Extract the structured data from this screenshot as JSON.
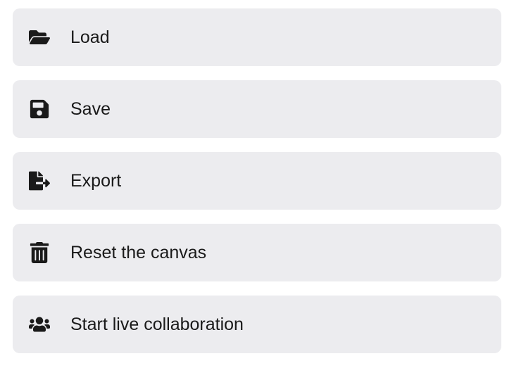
{
  "menu": {
    "items": [
      {
        "id": "load",
        "label": "Load",
        "icon": "folder-open-icon"
      },
      {
        "id": "save",
        "label": "Save",
        "icon": "save-icon"
      },
      {
        "id": "export",
        "label": "Export",
        "icon": "export-icon"
      },
      {
        "id": "reset",
        "label": "Reset the canvas",
        "icon": "trash-icon"
      },
      {
        "id": "collab",
        "label": "Start live collaboration",
        "icon": "users-icon"
      }
    ]
  }
}
